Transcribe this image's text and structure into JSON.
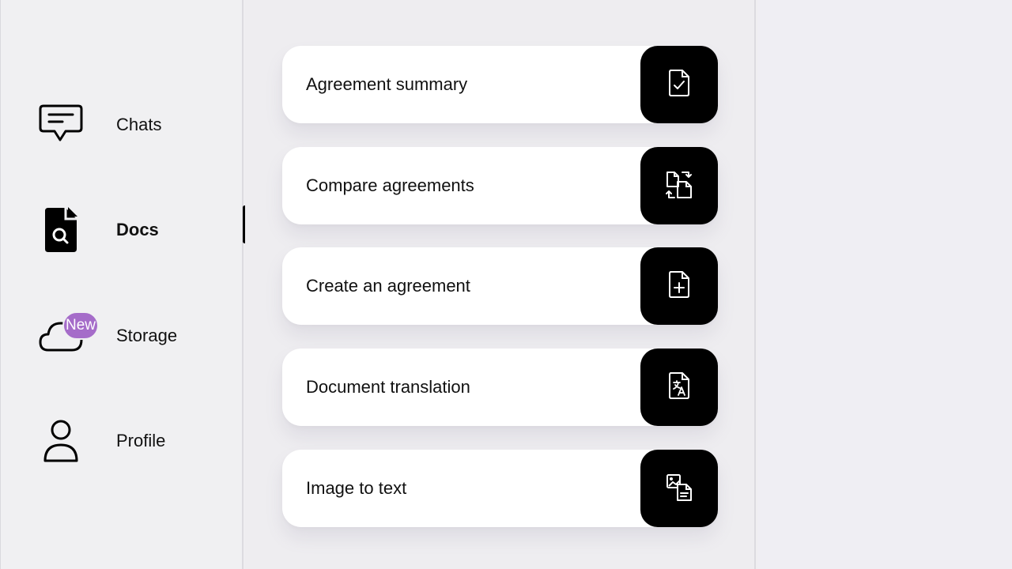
{
  "sidebar": {
    "items": [
      {
        "label": "Chats",
        "icon": "chat-bubble-icon"
      },
      {
        "label": "Docs",
        "icon": "doc-search-icon",
        "active": true
      },
      {
        "label": "Storage",
        "icon": "cloud-icon",
        "badge": "New"
      },
      {
        "label": "Profile",
        "icon": "person-icon"
      }
    ]
  },
  "main": {
    "cards": [
      {
        "label": "Agreement summary",
        "icon": "doc-check-icon"
      },
      {
        "label": "Compare agreements",
        "icon": "doc-compare-icon"
      },
      {
        "label": "Create an agreement",
        "icon": "doc-plus-icon"
      },
      {
        "label": "Document translation",
        "icon": "doc-translate-icon"
      },
      {
        "label": "Image to text",
        "icon": "image-to-text-icon"
      }
    ]
  },
  "colors": {
    "badge": "#a56cc9",
    "action_button": "#000000",
    "background": "#efeef1"
  }
}
